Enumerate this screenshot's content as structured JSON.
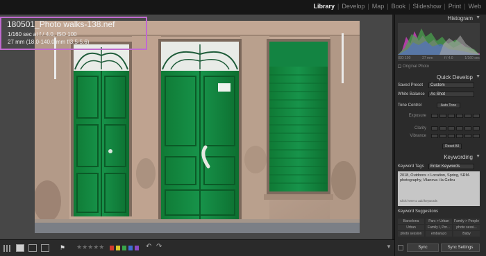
{
  "modules": [
    "Library",
    "Develop",
    "Map",
    "Book",
    "Slideshow",
    "Print",
    "Web"
  ],
  "active_module": "Library",
  "info_overlay": {
    "filename": "180501_Photo walks-138.nef",
    "line2": "1/160 sec at f / 4.0, ISO 100",
    "line3": "27 mm (18.0-140.0 mm f/3.5-5.6)",
    "border_color": "#c06ad0"
  },
  "panels": {
    "histogram": {
      "title": "Histogram",
      "meta": [
        "ISO 100",
        "27 mm",
        "f / 4.0",
        "1/160 sec"
      ],
      "original_photo_label": "Original Photo"
    },
    "quick_develop": {
      "title": "Quick Develop",
      "saved_preset_label": "Saved Preset",
      "saved_preset_value": "Custom",
      "white_balance_label": "White Balance",
      "white_balance_value": "As Shot",
      "tone_control_label": "Tone Control",
      "auto_tone_label": "Auto Tone",
      "exposure_label": "Exposure",
      "clarity_label": "Clarity",
      "vibrance_label": "Vibrance",
      "reset_all_label": "Reset All"
    },
    "keywording": {
      "title": "Keywording",
      "keyword_tags_label": "Keyword Tags",
      "keyword_tags_value": "Enter Keywords",
      "keywords_text": "2018, Outdoors < Location, Spring, SRM-photography, Vilanova i la Geltru",
      "hint": "Click here to add keywords"
    },
    "keyword_suggestions": {
      "title": "Keyword Suggestions",
      "items": [
        "Barcelona",
        "Parc > Urban",
        "Family > People",
        "Urban",
        "Family I, Por...",
        "photo sessi...",
        "photo session",
        "embarazo",
        "Baby"
      ]
    },
    "sync": {
      "sync_label": "Sync",
      "sync_settings_label": "Sync Settings"
    }
  },
  "toolbar": {
    "rating_stars": "★★★★★",
    "label_colors": [
      "#d23b2e",
      "#d9c82b",
      "#3aa64a",
      "#3f6fd3",
      "#8a4ac4"
    ],
    "rotate_left_icon": "rotate-left-icon",
    "rotate_right_icon": "rotate-right-icon",
    "menu_icon": "chevron-down-icon"
  }
}
